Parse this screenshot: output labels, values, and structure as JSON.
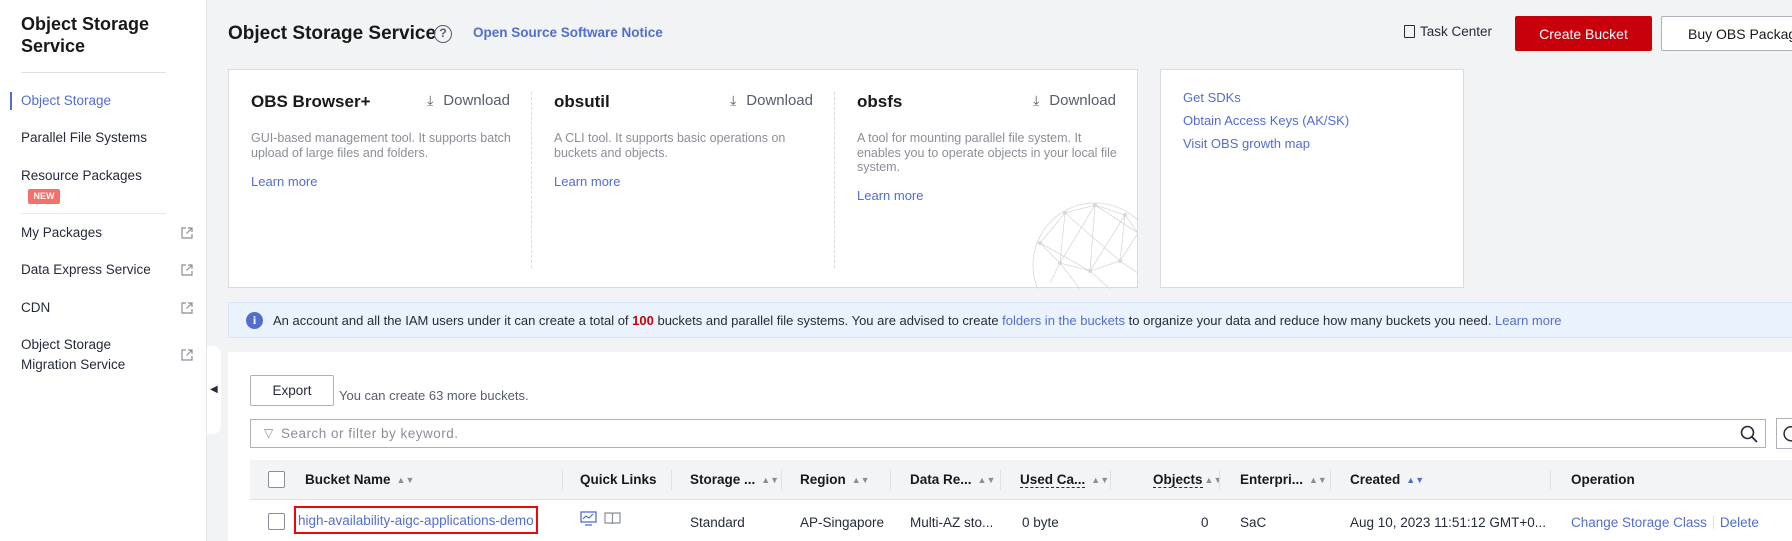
{
  "sidebar": {
    "title": "Object Storage Service",
    "items": [
      {
        "label": "Object Storage",
        "active": true
      },
      {
        "label": "Parallel File Systems"
      },
      {
        "label": "Resource Packages",
        "badge": "NEW"
      },
      {
        "label": "My Packages",
        "external": true
      },
      {
        "label": "Data Express Service",
        "external": true
      },
      {
        "label": "CDN",
        "external": true
      },
      {
        "label": "Object Storage Migration Service",
        "external": true
      }
    ]
  },
  "header": {
    "title": "Object Storage Service",
    "notice_link": "Open Source Software Notice",
    "task_center": "Task Center",
    "create_bucket": "Create Bucket",
    "buy_packages": "Buy OBS Packages"
  },
  "tools": [
    {
      "name": "OBS Browser+",
      "download": "Download",
      "description": "GUI-based management tool. It supports batch upload of large files and folders.",
      "learn_more": "Learn more"
    },
    {
      "name": "obsutil",
      "download": "Download",
      "description": "A CLI tool. It supports basic operations on buckets and objects.",
      "learn_more": "Learn more"
    },
    {
      "name": "obsfs",
      "download": "Download",
      "description": "A tool for mounting parallel file system. It enables you to operate objects in your local file system.",
      "learn_more": "Learn more"
    }
  ],
  "quick_links": [
    "Get SDKs",
    "Obtain Access Keys (AK/SK)",
    "Visit OBS growth map"
  ],
  "info": {
    "prefix": "An account and all the IAM users under it can create a total of ",
    "count": "100",
    "middle": " buckets and parallel file systems. You are advised to create ",
    "link": "folders in the buckets",
    "suffix": " to organize your data and reduce how many buckets you need. ",
    "learn_more": "Learn more"
  },
  "table": {
    "export": "Export",
    "remaining": "You can create 63 more buckets.",
    "search_placeholder": "Search or filter by keyword.",
    "columns": [
      "Bucket Name",
      "Quick Links",
      "Storage ...",
      "Region",
      "Data Re...",
      "Used Ca...",
      "Objects",
      "Enterpri...",
      "Created",
      "Operation"
    ],
    "rows": [
      {
        "bucket_name": "high-availability-aigc-applications-demo",
        "storage_class": "Standard",
        "region": "AP-Singapore",
        "data_redundancy": "Multi-AZ sto...",
        "used_capacity": "0 byte",
        "objects": "0",
        "enterprise_project": "SaC",
        "created": "Aug 10, 2023 11:51:12 GMT+0...",
        "op_change": "Change Storage Class",
        "op_delete": "Delete"
      }
    ]
  },
  "colors": {
    "brand_red": "#c7000b",
    "link_blue": "#526ecc",
    "highlight_border": "#e8070f"
  }
}
